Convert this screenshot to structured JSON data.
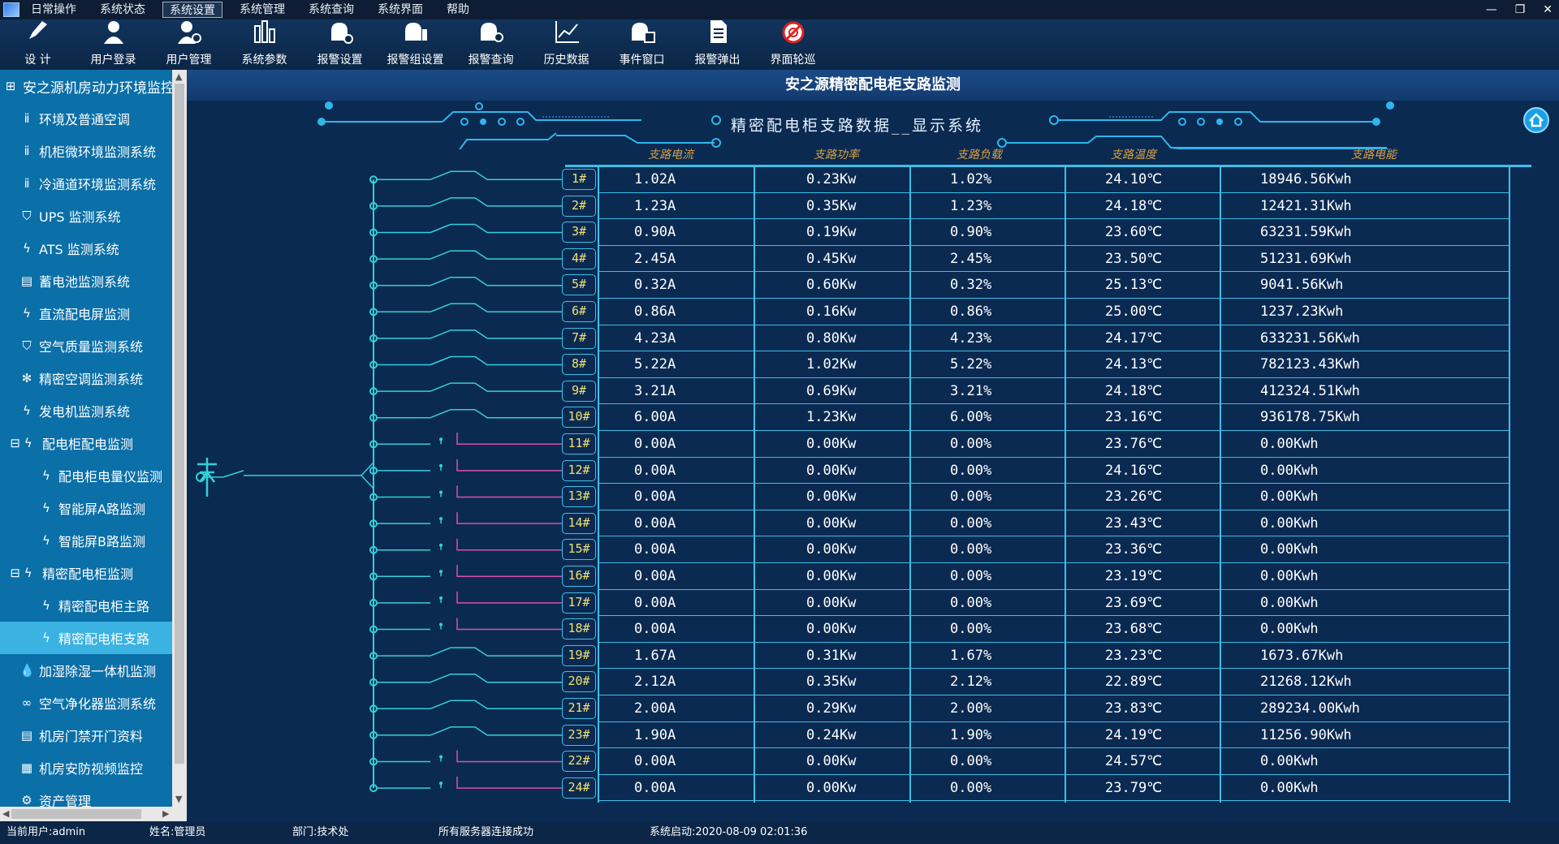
{
  "menu": [
    "日常操作",
    "系统状态",
    "系统设置",
    "系统管理",
    "系统查询",
    "系统界面",
    "帮助"
  ],
  "menu_active": 2,
  "window_controls": [
    "—",
    "❐",
    "✕"
  ],
  "toolbar": [
    {
      "label": "设 计",
      "icon": "brush-icon"
    },
    {
      "label": "用户登录",
      "icon": "user-icon"
    },
    {
      "label": "用户管理",
      "icon": "user-gear-icon"
    },
    {
      "label": "系统参数",
      "icon": "bars-icon"
    },
    {
      "label": "报警设置",
      "icon": "alarm-gear-icon"
    },
    {
      "label": "报警组设置",
      "icon": "alarm-group-icon"
    },
    {
      "label": "报警查询",
      "icon": "alarm-search-icon"
    },
    {
      "label": "历史数据",
      "icon": "chart-icon"
    },
    {
      "label": "事件窗口",
      "icon": "event-window-icon"
    },
    {
      "label": "报警弹出",
      "icon": "document-icon"
    },
    {
      "label": "界面轮巡",
      "icon": "cycle-icon"
    }
  ],
  "sidebar": [
    {
      "label": "安之源机房动力环境监控",
      "level": "l0",
      "icon": "⊞",
      "ico_name": "grid-icon"
    },
    {
      "label": "环境及普通空调",
      "level": "l1",
      "icon": "ⅱ",
      "ico_name": "sensor-icon"
    },
    {
      "label": "机柜微环境监测系统",
      "level": "l1",
      "icon": "ⅱ",
      "ico_name": "sensor-icon"
    },
    {
      "label": "冷通道环境监测系统",
      "level": "l1",
      "icon": "ⅱ",
      "ico_name": "sensor-icon"
    },
    {
      "label": "UPS 监测系统",
      "level": "l1",
      "icon": "⛉",
      "ico_name": "shield-icon"
    },
    {
      "label": "ATS 监测系统",
      "level": "l1",
      "icon": "ϟ",
      "ico_name": "bolt-icon"
    },
    {
      "label": "蓄电池监测系统",
      "level": "l1",
      "icon": "▤",
      "ico_name": "battery-icon"
    },
    {
      "label": "直流配电屏监测",
      "level": "l1",
      "icon": "ϟ",
      "ico_name": "bolt-icon"
    },
    {
      "label": "空气质量监测系统",
      "level": "l1",
      "icon": "⛉",
      "ico_name": "shield-icon"
    },
    {
      "label": "精密空调监测系统",
      "level": "l1",
      "icon": "✻",
      "ico_name": "snowflake-icon"
    },
    {
      "label": "发电机监测系统",
      "level": "l1",
      "icon": "ϟ",
      "ico_name": "bolt-icon"
    },
    {
      "label": "配电柜配电监测",
      "level": "l1e",
      "icon": "⊟ ϟ",
      "ico_name": "collapse-bolt-icon"
    },
    {
      "label": "配电柜电量仪监测",
      "level": "l2",
      "icon": "ϟ",
      "ico_name": "bolt-icon"
    },
    {
      "label": "智能屏A路监测",
      "level": "l2",
      "icon": "ϟ",
      "ico_name": "bolt-icon"
    },
    {
      "label": "智能屏B路监测",
      "level": "l2",
      "icon": "ϟ",
      "ico_name": "bolt-icon"
    },
    {
      "label": "精密配电柜监测",
      "level": "l1e",
      "icon": "⊟ ϟ",
      "ico_name": "collapse-bolt-icon"
    },
    {
      "label": "精密配电柜主路",
      "level": "l2",
      "icon": "ϟ",
      "ico_name": "bolt-icon"
    },
    {
      "label": "精密配电柜支路",
      "level": "l2",
      "icon": "ϟ",
      "ico_name": "bolt-icon",
      "selected": true
    },
    {
      "label": "加湿除湿一体机监测",
      "level": "l1",
      "icon": "💧",
      "ico_name": "droplet-icon"
    },
    {
      "label": "空气净化器监测系统",
      "level": "l1",
      "icon": "∞",
      "ico_name": "purifier-icon"
    },
    {
      "label": "机房门禁开门资料",
      "level": "l1",
      "icon": "▤",
      "ico_name": "list-icon"
    },
    {
      "label": "机房安防视频监控",
      "level": "l1",
      "icon": "▦",
      "ico_name": "video-icon"
    },
    {
      "label": "资产管理",
      "level": "l1",
      "icon": "⚙",
      "ico_name": "asset-icon"
    }
  ],
  "page_title": "安之源精密配电柜支路监测",
  "subtitle": "精密配电柜支路数据__显示系统",
  "columns": [
    "支路电流",
    "支路功率",
    "支路负载",
    "支路温度",
    "支路电能"
  ],
  "rows": [
    {
      "id": "1#",
      "current": "1.02A",
      "power": "0.23Kw",
      "load": "1.02%",
      "temp": "24.10℃",
      "energy": "18946.56Kwh",
      "state": "on"
    },
    {
      "id": "2#",
      "current": "1.23A",
      "power": "0.35Kw",
      "load": "1.23%",
      "temp": "24.18℃",
      "energy": "12421.31Kwh",
      "state": "on"
    },
    {
      "id": "3#",
      "current": "0.90A",
      "power": "0.19Kw",
      "load": "0.90%",
      "temp": "23.60℃",
      "energy": "63231.59Kwh",
      "state": "on"
    },
    {
      "id": "4#",
      "current": "2.45A",
      "power": "0.45Kw",
      "load": "2.45%",
      "temp": "23.50℃",
      "energy": "51231.69Kwh",
      "state": "on"
    },
    {
      "id": "5#",
      "current": "0.32A",
      "power": "0.60Kw",
      "load": "0.32%",
      "temp": "25.13℃",
      "energy": "9041.56Kwh",
      "state": "on"
    },
    {
      "id": "6#",
      "current": "0.86A",
      "power": "0.16Kw",
      "load": "0.86%",
      "temp": "25.00℃",
      "energy": "1237.23Kwh",
      "state": "on"
    },
    {
      "id": "7#",
      "current": "4.23A",
      "power": "0.80Kw",
      "load": "4.23%",
      "temp": "24.17℃",
      "energy": "633231.56Kwh",
      "state": "on"
    },
    {
      "id": "8#",
      "current": "5.22A",
      "power": "1.02Kw",
      "load": "5.22%",
      "temp": "24.13℃",
      "energy": "782123.43Kwh",
      "state": "on"
    },
    {
      "id": "9#",
      "current": "3.21A",
      "power": "0.69Kw",
      "load": "3.21%",
      "temp": "24.18℃",
      "energy": "412324.51Kwh",
      "state": "on"
    },
    {
      "id": "10#",
      "current": "6.00A",
      "power": "1.23Kw",
      "load": "6.00%",
      "temp": "23.16℃",
      "energy": "936178.75Kwh",
      "state": "on"
    },
    {
      "id": "11#",
      "current": "0.00A",
      "power": "0.00Kw",
      "load": "0.00%",
      "temp": "23.76℃",
      "energy": "0.00Kwh",
      "state": "off"
    },
    {
      "id": "12#",
      "current": "0.00A",
      "power": "0.00Kw",
      "load": "0.00%",
      "temp": "24.16℃",
      "energy": "0.00Kwh",
      "state": "off"
    },
    {
      "id": "13#",
      "current": "0.00A",
      "power": "0.00Kw",
      "load": "0.00%",
      "temp": "23.26℃",
      "energy": "0.00Kwh",
      "state": "off"
    },
    {
      "id": "14#",
      "current": "0.00A",
      "power": "0.00Kw",
      "load": "0.00%",
      "temp": "23.43℃",
      "energy": "0.00Kwh",
      "state": "off"
    },
    {
      "id": "15#",
      "current": "0.00A",
      "power": "0.00Kw",
      "load": "0.00%",
      "temp": "23.36℃",
      "energy": "0.00Kwh",
      "state": "off"
    },
    {
      "id": "16#",
      "current": "0.00A",
      "power": "0.00Kw",
      "load": "0.00%",
      "temp": "23.19℃",
      "energy": "0.00Kwh",
      "state": "off"
    },
    {
      "id": "17#",
      "current": "0.00A",
      "power": "0.00Kw",
      "load": "0.00%",
      "temp": "23.69℃",
      "energy": "0.00Kwh",
      "state": "off"
    },
    {
      "id": "18#",
      "current": "0.00A",
      "power": "0.00Kw",
      "load": "0.00%",
      "temp": "23.68℃",
      "energy": "0.00Kwh",
      "state": "off"
    },
    {
      "id": "19#",
      "current": "1.67A",
      "power": "0.31Kw",
      "load": "1.67%",
      "temp": "23.23℃",
      "energy": "1673.67Kwh",
      "state": "on"
    },
    {
      "id": "20#",
      "current": "2.12A",
      "power": "0.35Kw",
      "load": "2.12%",
      "temp": "22.89℃",
      "energy": "21268.12Kwh",
      "state": "on"
    },
    {
      "id": "21#",
      "current": "2.00A",
      "power": "0.29Kw",
      "load": "2.00%",
      "temp": "23.83℃",
      "energy": "289234.00Kwh",
      "state": "on"
    },
    {
      "id": "23#",
      "current": "1.90A",
      "power": "0.24Kw",
      "load": "1.90%",
      "temp": "24.19℃",
      "energy": "11256.90Kwh",
      "state": "on"
    },
    {
      "id": "22#",
      "current": "0.00A",
      "power": "0.00Kw",
      "load": "0.00%",
      "temp": "24.57℃",
      "energy": "0.00Kwh",
      "state": "off"
    },
    {
      "id": "24#",
      "current": "0.00A",
      "power": "0.00Kw",
      "load": "0.00%",
      "temp": "23.79℃",
      "energy": "0.00Kwh",
      "state": "off"
    }
  ],
  "colors": {
    "on": "#33d0d8",
    "off": "#d84fb4",
    "grid": "#3cc0e6"
  },
  "status": {
    "user": "当前用户:admin",
    "name": "姓名:管理员",
    "dept": "部门:技术处",
    "server": "所有服务器连接成功",
    "start": "系统启动:2020-08-09 02:01:36"
  }
}
